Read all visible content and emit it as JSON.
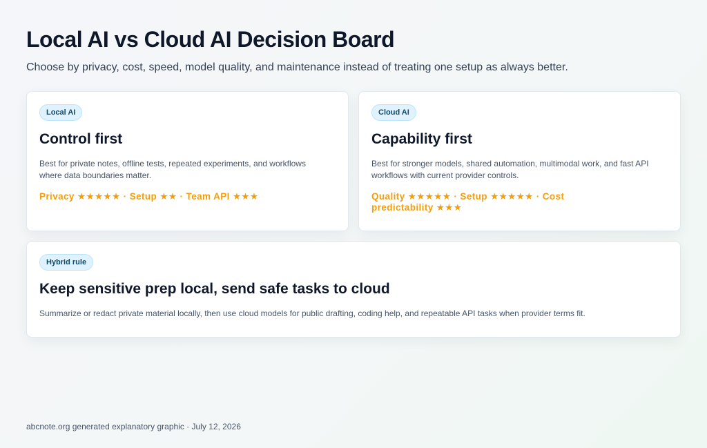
{
  "header": {
    "title": "Local AI vs Cloud AI Decision Board",
    "subtitle": "Choose by privacy, cost, speed, model quality, and maintenance instead of treating one setup as always better."
  },
  "cards": [
    {
      "badge": "Local AI",
      "title": "Control first",
      "description": "Best for private notes, offline tests, repeated experiments, and workflows where data boundaries matter.",
      "ratings": "Privacy ★★★★★ · Setup ★★ · Team API ★★★"
    },
    {
      "badge": "Cloud AI",
      "title": "Capability first",
      "description": "Best for stronger models, shared automation, multimodal work, and fast API workflows with current provider controls.",
      "ratings": "Quality ★★★★★ · Setup ★★★★★ · Cost predictability ★★★"
    },
    {
      "badge": "Hybrid rule",
      "title": "Keep sensitive prep local, send safe tasks to cloud",
      "description": "Summarize or redact private material locally, then use cloud models for public drafting, coding help, and repeatable API tasks when provider terms fit."
    }
  ],
  "footer": "abcnote.org generated explanatory graphic · July 12, 2026",
  "colors": {
    "rating_accent": "#f59e0b",
    "badge_bg": "#e0f2fe",
    "badge_text": "#0c4a6e",
    "title_text": "#0f172a"
  }
}
